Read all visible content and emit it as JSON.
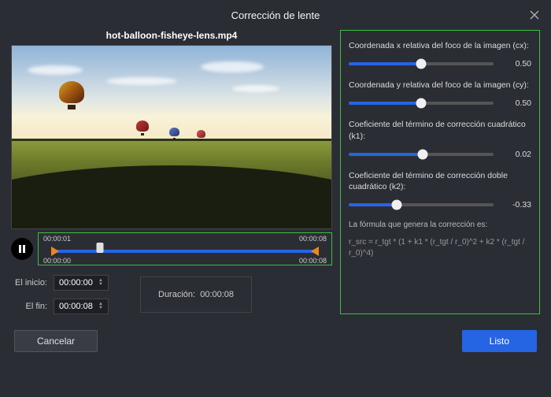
{
  "dialog": {
    "title": "Corrección de lente",
    "filename": "hot-balloon-fisheye-lens.mp4"
  },
  "playback": {
    "current_time": "00:00:01",
    "total_time": "00:00:08",
    "start_marker": "00:00:00",
    "end_marker": "00:00:08"
  },
  "time_controls": {
    "start_label": "El inicio:",
    "start_value": "00:00:00",
    "end_label": "El fin:",
    "end_value": "00:00:08",
    "duration_label": "Duración:",
    "duration_value": "00:00:08"
  },
  "params": {
    "cx": {
      "label": "Coordenada x relativa del foco de la imagen (cx):",
      "value": "0.50",
      "percent": 50
    },
    "cy": {
      "label": "Coordenada y relativa del foco de la imagen (cy):",
      "value": "0.50",
      "percent": 50
    },
    "k1": {
      "label": "Coeficiente del término de corrección cuadrático (k1):",
      "value": "0.02",
      "percent": 51
    },
    "k2": {
      "label": "Coeficiente del término de corrección doble cuadrático (k2):",
      "value": "-0.33",
      "percent": 33
    },
    "formula_label": "La fórmula que genera la corrección es:",
    "formula": "r_src = r_tgt * (1 + k1 * (r_tgt / r_0)^2 + k2 * (r_tgt / r_0)^4)"
  },
  "buttons": {
    "cancel": "Cancelar",
    "done": "Listo"
  }
}
